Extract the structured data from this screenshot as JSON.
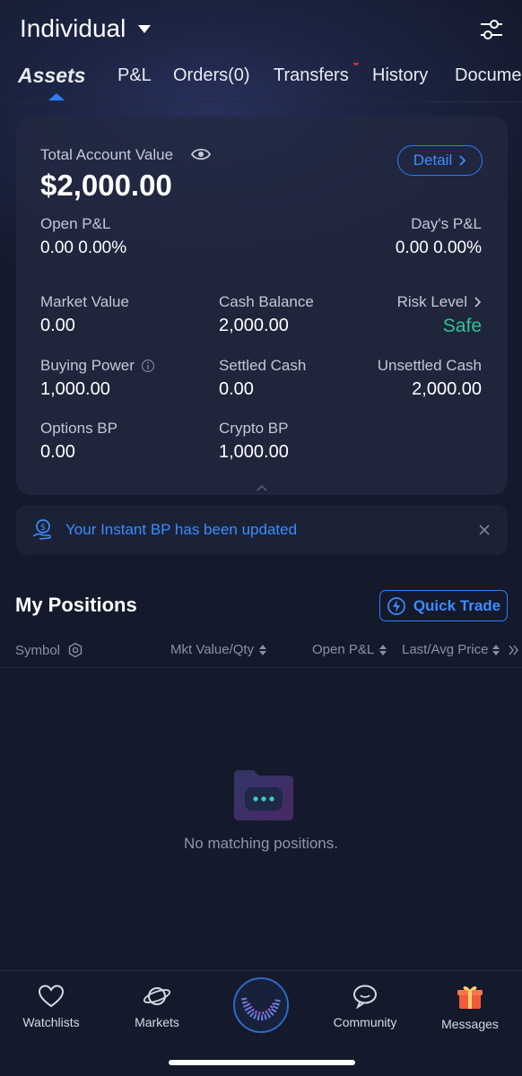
{
  "header": {
    "account_name": "Individual"
  },
  "tabs": [
    "Assets",
    "P&L",
    "Orders(0)",
    "Transfers",
    "History",
    "Docume"
  ],
  "account": {
    "total_label": "Total Account Value",
    "total_value": "$2,000.00",
    "detail_label": "Detail",
    "open_pl_label": "Open P&L",
    "open_pl_value": "0.00 0.00%",
    "days_pl_label": "Day's P&L",
    "days_pl_value": "0.00 0.00%",
    "market_value_label": "Market Value",
    "market_value": "0.00",
    "cash_balance_label": "Cash Balance",
    "cash_balance": "2,000.00",
    "risk_level_label": "Risk Level",
    "risk_level": "Safe",
    "buying_power_label": "Buying Power",
    "buying_power": "1,000.00",
    "settled_cash_label": "Settled Cash",
    "settled_cash": "0.00",
    "unsettled_cash_label": "Unsettled Cash",
    "unsettled_cash": "2,000.00",
    "options_bp_label": "Options BP",
    "options_bp": "0.00",
    "crypto_bp_label": "Crypto BP",
    "crypto_bp": "1,000.00"
  },
  "banner": {
    "text": "Your Instant BP has been updated"
  },
  "positions": {
    "title": "My Positions",
    "quick_trade": "Quick Trade",
    "columns": [
      "Symbol",
      "Mkt Value/Qty",
      "Open P&L",
      "Last/Avg Price"
    ],
    "empty_text": "No matching positions."
  },
  "nav": [
    "Watchlists",
    "Markets",
    "Community",
    "Messages"
  ],
  "colors": {
    "accent": "#2f7df6",
    "safe": "#2fc590",
    "background": "#141a2c",
    "card": "#222940"
  }
}
